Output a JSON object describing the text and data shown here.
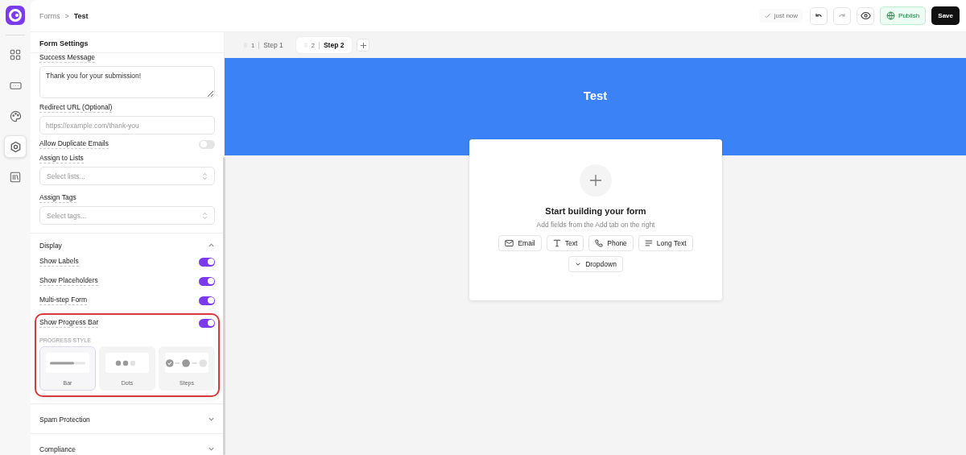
{
  "rail": [
    {
      "kind": "grid",
      "selected": false
    },
    {
      "kind": "input",
      "selected": false
    },
    {
      "kind": "palette",
      "selected": false
    },
    {
      "kind": "settings",
      "selected": true
    },
    {
      "kind": "library",
      "selected": false
    }
  ],
  "breadcrumb": {
    "parent": "Forms",
    "separator": ">",
    "current": "Test"
  },
  "toolbar": {
    "saved_status": "just now",
    "publish": "Publish",
    "save": "Save"
  },
  "panel": {
    "title": "Form Settings",
    "fields": [
      {
        "kind": "textarea",
        "label": "Success Message",
        "value": "Thank you for your submission!"
      },
      {
        "kind": "input",
        "label": "Redirect URL (Optional)",
        "placeholder": "https://example.com/thank-you"
      },
      {
        "kind": "toggle",
        "label": "Allow Duplicate Emails",
        "on": false
      },
      {
        "kind": "select",
        "label": "Assign to Lists",
        "placeholder": "Select lists..."
      },
      {
        "kind": "select",
        "label": "Assign Tags",
        "placeholder": "Select tags..."
      }
    ],
    "display": {
      "title": "Display",
      "expanded": true,
      "toggles": [
        {
          "label": "Show Labels",
          "on": true
        },
        {
          "label": "Show Placeholders",
          "on": true
        },
        {
          "label": "Multi-step Form",
          "on": true
        }
      ],
      "progress": {
        "label": "Show Progress Bar",
        "on": true,
        "style_heading": "PROGRESS STYLE",
        "styles": [
          {
            "kind": "bar",
            "label": "Bar",
            "selected": true
          },
          {
            "kind": "dots",
            "label": "Dots",
            "selected": false
          },
          {
            "kind": "steps",
            "label": "Steps",
            "selected": false
          }
        ]
      }
    },
    "sections": [
      {
        "title": "Spam Protection",
        "expanded": false
      },
      {
        "title": "Compliance",
        "expanded": false
      }
    ]
  },
  "steps": [
    {
      "number": "1",
      "label": "Step 1",
      "selected": false
    },
    {
      "number": "2",
      "label": "Step 2",
      "selected": true
    }
  ],
  "canvas": {
    "title": "Test",
    "empty": {
      "heading": "Start building your form",
      "hint": "Add fields from the Add tab on the right",
      "fields": [
        {
          "kind": "email",
          "label": "Email"
        },
        {
          "kind": "text",
          "label": "Text"
        },
        {
          "kind": "phone",
          "label": "Phone"
        },
        {
          "kind": "longtext",
          "label": "Long Text"
        },
        {
          "kind": "dropdown",
          "label": "Dropdown"
        }
      ]
    }
  }
}
